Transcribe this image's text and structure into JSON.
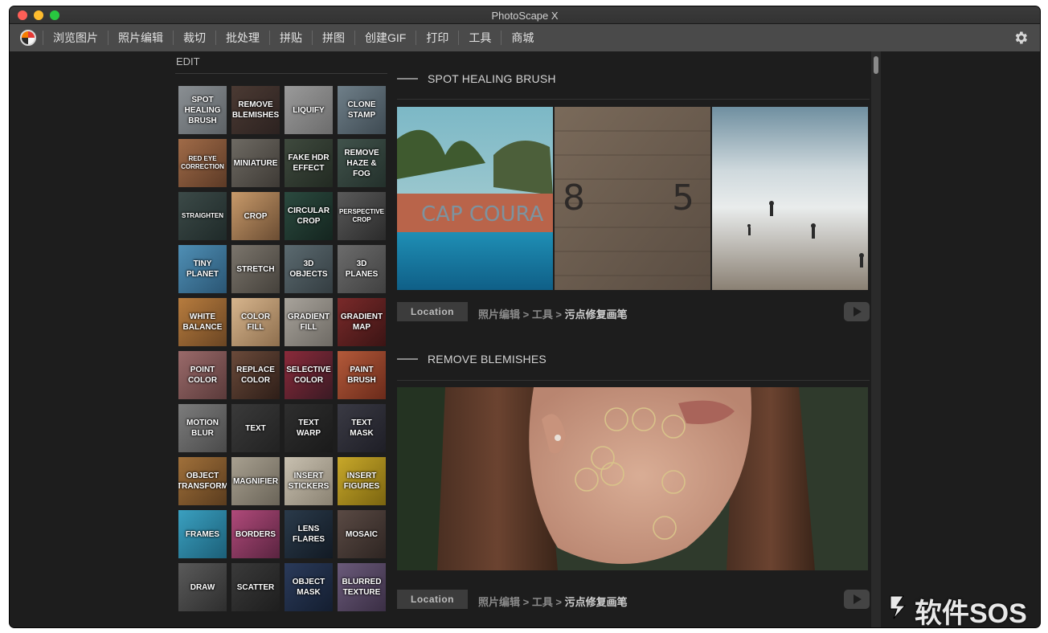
{
  "window": {
    "title": "PhotoScape X"
  },
  "toolbar": {
    "items": [
      "浏览图片",
      "照片编辑",
      "裁切",
      "批处理",
      "拼贴",
      "拼图",
      "创建GIF",
      "打印",
      "工具",
      "商城"
    ]
  },
  "edit_panel": {
    "heading": "EDIT",
    "tools": [
      {
        "label": "SPOT HEALING BRUSH",
        "small": false
      },
      {
        "label": "REMOVE BLEMISHES",
        "small": false
      },
      {
        "label": "LIQUIFY",
        "small": false
      },
      {
        "label": "CLONE STAMP",
        "small": false
      },
      {
        "label": "RED EYE CORRECTION",
        "small": true
      },
      {
        "label": "MINIATURE",
        "small": false
      },
      {
        "label": "FAKE HDR EFFECT",
        "small": false
      },
      {
        "label": "REMOVE HAZE & FOG",
        "small": false
      },
      {
        "label": "STRAIGHTEN",
        "small": true
      },
      {
        "label": "CROP",
        "small": false
      },
      {
        "label": "CIRCULAR CROP",
        "small": false
      },
      {
        "label": "PERSPECTIVE CROP",
        "small": true
      },
      {
        "label": "TINY PLANET",
        "small": false
      },
      {
        "label": "STRETCH",
        "small": false
      },
      {
        "label": "3D OBJECTS",
        "small": false
      },
      {
        "label": "3D PLANES",
        "small": false
      },
      {
        "label": "WHITE BALANCE",
        "small": false
      },
      {
        "label": "COLOR FILL",
        "small": false
      },
      {
        "label": "GRADIENT FILL",
        "small": false
      },
      {
        "label": "GRADIENT MAP",
        "small": false
      },
      {
        "label": "POINT COLOR",
        "small": false
      },
      {
        "label": "REPLACE COLOR",
        "small": false
      },
      {
        "label": "SELECTIVE COLOR",
        "small": false
      },
      {
        "label": "PAINT BRUSH",
        "small": false
      },
      {
        "label": "MOTION BLUR",
        "small": false
      },
      {
        "label": "TEXT",
        "small": false
      },
      {
        "label": "TEXT WARP",
        "small": false
      },
      {
        "label": "TEXT MASK",
        "small": false
      },
      {
        "label": "OBJECT TRANSFORM",
        "small": false
      },
      {
        "label": "MAGNIFIER",
        "small": false
      },
      {
        "label": "INSERT STICKERS",
        "small": false
      },
      {
        "label": "INSERT FIGURES",
        "small": false
      },
      {
        "label": "FRAMES",
        "small": false
      },
      {
        "label": "BORDERS",
        "small": false
      },
      {
        "label": "LENS FLARES",
        "small": false
      },
      {
        "label": "MOSAIC",
        "small": false
      },
      {
        "label": "DRAW",
        "small": false
      },
      {
        "label": "SCATTER",
        "small": false
      },
      {
        "label": "OBJECT MASK",
        "small": false
      },
      {
        "label": "BLURRED TEXTURE",
        "small": false
      }
    ]
  },
  "content": {
    "sections": [
      {
        "title": "SPOT HEALING BRUSH",
        "location_label": "Location",
        "path_prefix": "照片编辑 > 工具 > ",
        "path_current": "污点修复画笔",
        "boat_text": "CAP COURA",
        "wall_numbers": [
          "8",
          "5"
        ]
      },
      {
        "title": "REMOVE BLEMISHES",
        "location_label": "Location",
        "path_prefix": "照片编辑 > 工具 > ",
        "path_current": "污点修复画笔"
      }
    ]
  },
  "watermark": {
    "text": "软件SOS"
  },
  "colors": {
    "window_bg": "#1d1d1d",
    "toolbar_bg": "#4a4a4a",
    "close": "#ff5f57",
    "minimize": "#febc2e",
    "maximize": "#28c840"
  }
}
